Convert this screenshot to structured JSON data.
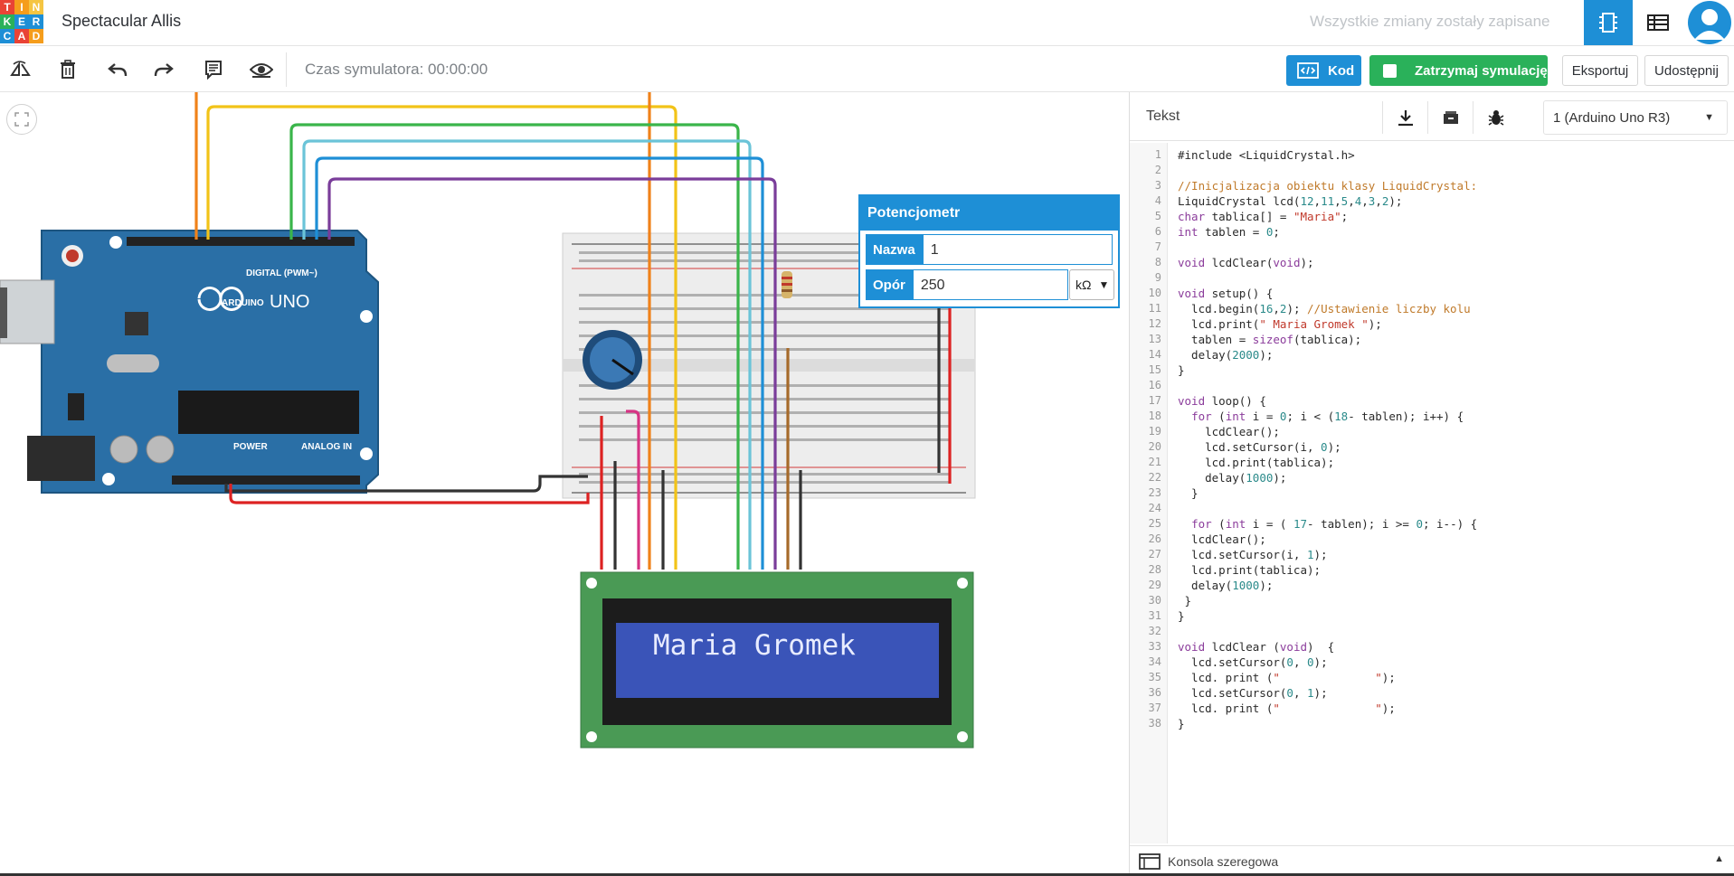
{
  "app": {
    "logo_letters": [
      "T",
      "I",
      "N",
      "K",
      "E",
      "R",
      "C",
      "A",
      "D"
    ],
    "logo_colors": [
      "#e94335",
      "#f59d1c",
      "#f5c542",
      "#2ab15a",
      "#1e8fd6",
      "#1e8fd6",
      "#1e8fd6",
      "#e94335",
      "#f59d1c"
    ],
    "project_title": "Spectacular Allis",
    "save_status": "Wszystkie zmiany zostały zapisane"
  },
  "toolbar": {
    "tools": [
      "rotate-icon",
      "delete-icon",
      "undo-icon",
      "redo-icon",
      "notes-icon",
      "visibility-icon"
    ],
    "sim_time": "Czas symulatora: 00:00:00",
    "code_label": "Kod",
    "stop_label": "Zatrzymaj symulację",
    "export_label": "Eksportuj",
    "share_label": "Udostępnij"
  },
  "properties": {
    "title": "Potencjometr",
    "name_label": "Nazwa",
    "name_value": "1",
    "resistance_label": "Opór",
    "resistance_value": "250",
    "unit": "kΩ"
  },
  "circuit": {
    "arduino_brand": "ARDUINO",
    "arduino_model": "UNO",
    "digital_label": "DIGITAL (PWM~)",
    "power_label": "POWER",
    "analog_label": "ANALOG IN",
    "lcd_text": "Maria Gromek"
  },
  "code_panel": {
    "mode": "Tekst",
    "board": "1 (Arduino Uno R3)",
    "serial_label": "Konsola szeregowa",
    "lines": [
      "#include <LiquidCrystal.h>",
      "",
      "//Inicjalizacja obiektu klasy LiquidCrystal:",
      "LiquidCrystal lcd(12,11,5,4,3,2);",
      "char tablica[] = \"Maria\";",
      "int tablen = 0;",
      "",
      "void lcdClear(void);",
      "",
      "void setup() {",
      "  lcd.begin(16,2); //Ustawienie liczby kolu",
      "  lcd.print(\" Maria Gromek \");",
      "  tablen = sizeof(tablica);",
      "  delay(2000);",
      "}",
      "",
      "void loop() {",
      "  for (int i = 0; i < (18- tablen); i++) {",
      "    lcdClear();",
      "    lcd.setCursor(i, 0);",
      "    lcd.print(tablica);",
      "    delay(1000);",
      "  }",
      "",
      "  for (int i = ( 17- tablen); i >= 0; i--) {",
      "  lcdClear();",
      "  lcd.setCursor(i, 1);",
      "  lcd.print(tablica);",
      "  delay(1000);",
      " }",
      "}",
      "",
      "void lcdClear (void)  {",
      "  lcd.setCursor(0, 0);",
      "  lcd. print (\"              \");",
      "  lcd.setCursor(0, 1);",
      "  lcd. print (\"              \");",
      "}"
    ]
  }
}
